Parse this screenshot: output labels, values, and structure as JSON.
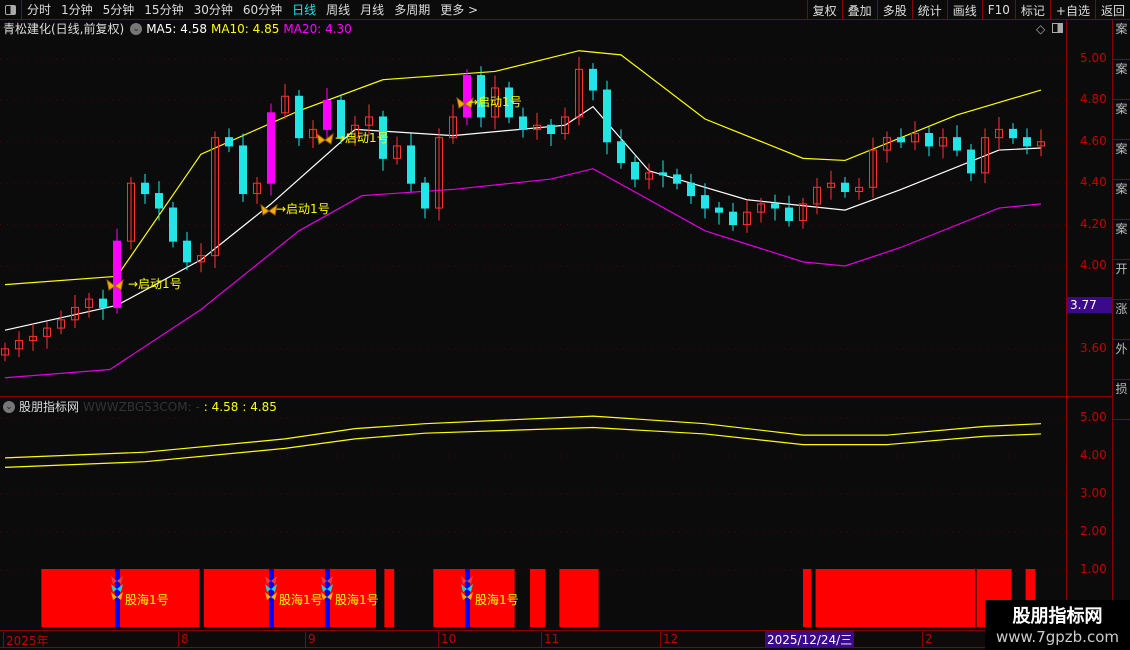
{
  "toolbar": {
    "periods": [
      "分时",
      "1分钟",
      "5分钟",
      "15分钟",
      "30分钟",
      "60分钟",
      "日线",
      "周线",
      "月线",
      "多周期",
      "更多 >"
    ],
    "active": "日线",
    "buttons": [
      "复权",
      "叠加",
      "多股",
      "统计",
      "画线",
      "F10",
      "标记",
      "+自选",
      "返回"
    ]
  },
  "info": {
    "title": "青松建化(日线,前复权)",
    "ma5": "MA5: 4.58",
    "ma10": "MA10: 4.85",
    "ma20": "MA20: 4.30"
  },
  "price_axis": {
    "labels": [
      "5.00",
      "4.80",
      "4.60",
      "4.40",
      "4.20",
      "4.00",
      "3.60"
    ],
    "current": "3.77"
  },
  "sub": {
    "title": "股朋指标网",
    "site": "WWWZBGS3COM: -",
    "v1": ": 4.58",
    "v2": ": 4.85",
    "axis": [
      "5.00",
      "4.00",
      "3.00",
      "2.00",
      "1.00"
    ]
  },
  "time_axis": {
    "labels": [
      "2025年",
      "8",
      "9",
      "10",
      "11",
      "12",
      "2"
    ],
    "cursor": "2025/12/24/三"
  },
  "watermark": {
    "name": "股朋指标网",
    "url": "www.7gpzb.com"
  },
  "right_strip": [
    "案",
    "案",
    "案",
    "案",
    "案",
    "案",
    "开",
    "涨",
    "外",
    "损"
  ],
  "colors": {
    "up": "#ff3030",
    "down": "#22e6e6",
    "signal": "#ff00ff",
    "upper": "#ffff00",
    "mid": "#ffffff",
    "lower": "#e000e0",
    "block": "#ff0000",
    "marker": "#0000ff"
  },
  "chart_data": {
    "type": "candlestick",
    "closes": [
      3.6,
      3.64,
      3.66,
      3.7,
      3.74,
      3.8,
      3.84,
      3.8,
      4.12,
      4.4,
      4.35,
      4.28,
      4.12,
      4.02,
      4.05,
      4.62,
      4.58,
      4.35,
      4.4,
      4.74,
      4.82,
      4.62,
      4.66,
      4.8,
      4.62,
      4.68,
      4.72,
      4.52,
      4.58,
      4.4,
      4.28,
      4.62,
      4.72,
      4.92,
      4.72,
      4.86,
      4.72,
      4.66,
      4.68,
      4.64,
      4.72,
      4.95,
      4.85,
      4.6,
      4.5,
      4.42,
      4.45,
      4.44,
      4.4,
      4.34,
      4.28,
      4.26,
      4.2,
      4.26,
      4.3,
      4.28,
      4.22,
      4.3,
      4.38,
      4.4,
      4.36,
      4.38,
      4.56,
      4.62,
      4.6,
      4.64,
      4.58,
      4.62,
      4.56,
      4.45,
      4.62,
      4.66,
      4.62,
      4.58,
      4.6
    ],
    "signal_bars": [
      8,
      19,
      23,
      33
    ],
    "signal_label": "→启动1号",
    "upper_band": [
      [
        0,
        3.91
      ],
      [
        8,
        3.95
      ],
      [
        14,
        4.54
      ],
      [
        21,
        4.75
      ],
      [
        27,
        4.9
      ],
      [
        35,
        4.94
      ],
      [
        41,
        5.04
      ],
      [
        44,
        5.02
      ],
      [
        50,
        4.71
      ],
      [
        57,
        4.52
      ],
      [
        60,
        4.51
      ],
      [
        68,
        4.73
      ],
      [
        74,
        4.85
      ]
    ],
    "mid_band": [
      [
        0,
        3.69
      ],
      [
        8,
        3.81
      ],
      [
        14,
        4.03
      ],
      [
        19,
        4.3
      ],
      [
        25,
        4.66
      ],
      [
        32,
        4.63
      ],
      [
        40,
        4.68
      ],
      [
        42,
        4.77
      ],
      [
        46,
        4.46
      ],
      [
        53,
        4.32
      ],
      [
        60,
        4.27
      ],
      [
        64,
        4.37
      ],
      [
        71,
        4.56
      ],
      [
        74,
        4.57
      ]
    ],
    "lower_band": [
      [
        0,
        3.46
      ],
      [
        7.5,
        3.5
      ],
      [
        14,
        3.79
      ],
      [
        21,
        4.17
      ],
      [
        25.5,
        4.34
      ],
      [
        32,
        4.37
      ],
      [
        39,
        4.42
      ],
      [
        42,
        4.47
      ],
      [
        50,
        4.17
      ],
      [
        57,
        4.02
      ],
      [
        60,
        4.0
      ],
      [
        64,
        4.09
      ],
      [
        71,
        4.28
      ],
      [
        74,
        4.3
      ]
    ],
    "sub_line1": [
      [
        0,
        3.95
      ],
      [
        10,
        4.1
      ],
      [
        20,
        4.45
      ],
      [
        25,
        4.72
      ],
      [
        30,
        4.85
      ],
      [
        42,
        5.05
      ],
      [
        50,
        4.85
      ],
      [
        57,
        4.55
      ],
      [
        63,
        4.55
      ],
      [
        70,
        4.78
      ],
      [
        74,
        4.85
      ]
    ],
    "sub_line2": [
      [
        0,
        3.7
      ],
      [
        10,
        3.85
      ],
      [
        20,
        4.2
      ],
      [
        25,
        4.45
      ],
      [
        30,
        4.6
      ],
      [
        42,
        4.75
      ],
      [
        50,
        4.58
      ],
      [
        57,
        4.3
      ],
      [
        63,
        4.3
      ],
      [
        70,
        4.52
      ],
      [
        74,
        4.58
      ]
    ],
    "sub_blocks": [
      [
        2.6,
        13.9
      ],
      [
        14.2,
        26.5
      ],
      [
        27.1,
        27.8
      ],
      [
        30.6,
        36.4
      ],
      [
        37.5,
        38.6
      ],
      [
        39.6,
        42.4
      ],
      [
        57,
        57.6
      ],
      [
        57.9,
        69.3
      ],
      [
        69.4,
        71.9
      ],
      [
        72.9,
        73.6
      ]
    ],
    "sub_signal_label": "股海1号",
    "price_range": [
      3.5,
      5.1
    ]
  }
}
